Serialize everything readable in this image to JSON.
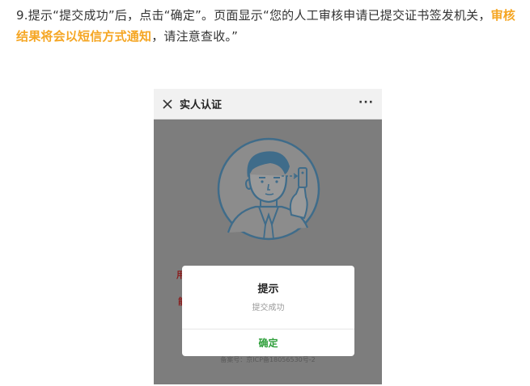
{
  "article": {
    "text_before": "9.提示“提交成功”后，点击“确定”。页面显示“您的人工审核申请已提交证书签发机关，",
    "highlight": "审核结果将会以短信方式通知",
    "text_after": "，请注意查收。”"
  },
  "phone": {
    "titlebar": {
      "close_icon": "close-icon",
      "title": "实人认证",
      "more": "···"
    },
    "background_fragments": {
      "left_char_1": "用",
      "left_char_2": "能"
    },
    "footer": "备案号：京ICP备18056530号-2",
    "dialog": {
      "title": "提示",
      "message": "提交成功",
      "confirm_label": "确定"
    }
  },
  "colors": {
    "highlight": "#f5a623",
    "confirm_green": "#2e9f3a",
    "overlay_gray": "#7d7d7d"
  }
}
